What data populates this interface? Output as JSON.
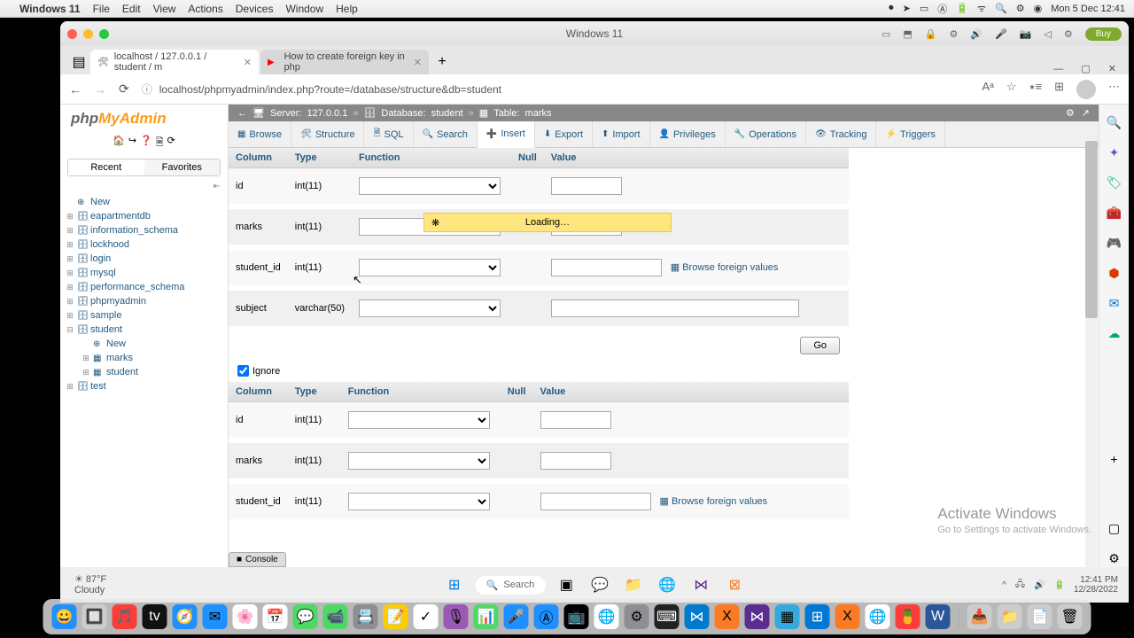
{
  "mac_menu": {
    "app": "Windows 11",
    "items": [
      "File",
      "Edit",
      "View",
      "Actions",
      "Devices",
      "Window",
      "Help"
    ],
    "clock": "Mon 5 Dec 12:41"
  },
  "window": {
    "title": "Windows 11",
    "buy": "Buy"
  },
  "browser": {
    "tab1": "localhost / 127.0.0.1 / student / m",
    "tab2": "How to create foreign key in php",
    "url": "localhost/phpmyadmin/index.php?route=/database/structure&db=student"
  },
  "pma": {
    "logo1": "php",
    "logo2": "MyAdmin",
    "nav_tabs": {
      "recent": "Recent",
      "fav": "Favorites"
    },
    "tree": {
      "new": "New",
      "dbs": [
        "eapartmentdb",
        "information_schema",
        "lockhood",
        "login",
        "mysql",
        "performance_schema",
        "phpmyadmin",
        "sample"
      ],
      "student": "student",
      "student_new": "New",
      "student_tables": [
        "marks",
        "student"
      ],
      "test": "test"
    },
    "breadcrumb": {
      "server_label": "Server:",
      "server": "127.0.0.1",
      "db_label": "Database:",
      "db": "student",
      "table_label": "Table:",
      "table": "marks"
    },
    "tabs": [
      "Browse",
      "Structure",
      "SQL",
      "Search",
      "Insert",
      "Export",
      "Import",
      "Privileges",
      "Operations",
      "Tracking",
      "Triggers"
    ],
    "headers": {
      "column": "Column",
      "type": "Type",
      "function": "Function",
      "null": "Null",
      "value": "Value"
    },
    "rows1": [
      {
        "col": "id",
        "type": "int(11)",
        "val_class": "val-sm"
      },
      {
        "col": "marks",
        "type": "int(11)",
        "val_class": "val-sm"
      },
      {
        "col": "student_id",
        "type": "int(11)",
        "val_class": "val-md",
        "fk": true
      },
      {
        "col": "subject",
        "type": "varchar(50)",
        "val_class": "val-lg"
      }
    ],
    "rows2": [
      {
        "col": "id",
        "type": "int(11)",
        "val_class": "val-sm"
      },
      {
        "col": "marks",
        "type": "int(11)",
        "val_class": "val-sm"
      },
      {
        "col": "student_id",
        "type": "int(11)",
        "val_class": "val-md",
        "fk": true
      }
    ],
    "browse_fk": "Browse foreign values",
    "go": "Go",
    "ignore": "Ignore",
    "loading": "Loading…",
    "console": "Console"
  },
  "activate": {
    "title": "Activate Windows",
    "sub": "Go to Settings to activate Windows."
  },
  "wintask": {
    "temp": "87°F",
    "weather": "Cloudy",
    "search": "Search",
    "time": "12:41 PM",
    "date": "12/28/2022"
  }
}
